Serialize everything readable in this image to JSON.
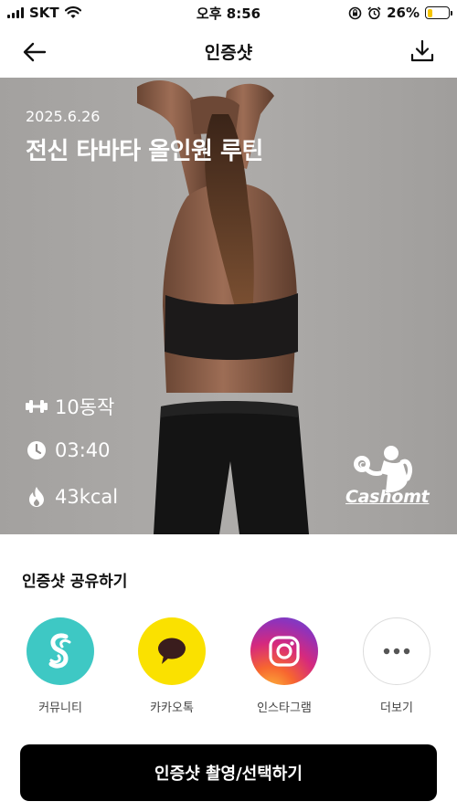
{
  "status_bar": {
    "carrier": "SKT",
    "time": "오후 8:56",
    "battery_percent": "26%",
    "battery_level": 0.26,
    "icons": [
      "signal-icon",
      "wifi-icon",
      "orientation-lock-icon",
      "alarm-icon",
      "battery-icon"
    ]
  },
  "nav": {
    "title": "인증샷",
    "back_icon": "arrow-left-icon",
    "download_icon": "download-icon"
  },
  "photo": {
    "date": "2025.6.26",
    "title": "전신 타바타 올인원 루틴",
    "stats": [
      {
        "icon": "dumbbell-icon",
        "label": "10동작"
      },
      {
        "icon": "clock-icon",
        "label": "03:40"
      },
      {
        "icon": "flame-icon",
        "label": "43kcal"
      }
    ],
    "logo_text": "Cashomt"
  },
  "share": {
    "title": "인증샷 공유하기",
    "items": [
      {
        "label": "커뮤니티",
        "icon": "community-icon",
        "color": "#3ec8c4"
      },
      {
        "label": "카카오톡",
        "icon": "kakaotalk-icon",
        "color": "#fae100"
      },
      {
        "label": "인스타그램",
        "icon": "instagram-icon",
        "color": "#d6297d"
      },
      {
        "label": "더보기",
        "icon": "more-icon",
        "color": "#ffffff"
      }
    ]
  },
  "primary_button": {
    "label": "인증샷 촬영/선택하기"
  }
}
